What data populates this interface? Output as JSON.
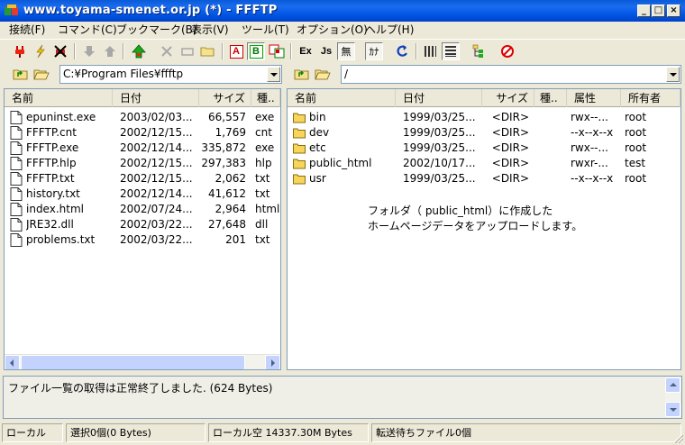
{
  "window": {
    "title": "www.toyama-smenet.or.jp (*) - FFFTP",
    "minimize": "_",
    "maximize": "□",
    "close": "×"
  },
  "menu": [
    {
      "label": "接続(F)"
    },
    {
      "label": "コマンド(C)"
    },
    {
      "label": "ブックマーク(B)"
    },
    {
      "label": "表示(V)"
    },
    {
      "label": "ツール(T)"
    },
    {
      "label": "オプション(O)"
    },
    {
      "label": "ヘルプ(H)"
    }
  ],
  "toolbar": {
    "text_buttons": {
      "ascii": "A",
      "binary": "B",
      "exe_case": "Ex",
      "jis": "Js",
      "no_conv": "無",
      "kana": "ｶﾅ"
    }
  },
  "local": {
    "path": "C:¥Program Files¥ffftp",
    "columns": [
      "名前",
      "日付",
      "サイズ",
      "種.."
    ],
    "files": [
      {
        "name": "epuninst.exe",
        "date": "2003/02/03...",
        "size": "66,557",
        "type": "exe"
      },
      {
        "name": "FFFTP.cnt",
        "date": "2002/12/15...",
        "size": "1,769",
        "type": "cnt"
      },
      {
        "name": "FFFTP.exe",
        "date": "2002/12/14...",
        "size": "335,872",
        "type": "exe"
      },
      {
        "name": "FFFTP.hlp",
        "date": "2002/12/15...",
        "size": "297,383",
        "type": "hlp"
      },
      {
        "name": "FFFTP.txt",
        "date": "2002/12/15...",
        "size": "2,062",
        "type": "txt"
      },
      {
        "name": "history.txt",
        "date": "2002/12/14...",
        "size": "41,612",
        "type": "txt"
      },
      {
        "name": "index.html",
        "date": "2002/07/24...",
        "size": "2,964",
        "type": "html"
      },
      {
        "name": "JRE32.dll",
        "date": "2002/03/22...",
        "size": "27,648",
        "type": "dll"
      },
      {
        "name": "problems.txt",
        "date": "2002/03/22...",
        "size": "201",
        "type": "txt"
      }
    ]
  },
  "remote": {
    "path": "/",
    "columns": [
      "名前",
      "日付",
      "サイズ",
      "種..",
      "属性",
      "所有者"
    ],
    "files": [
      {
        "name": "bin",
        "date": "1999/03/25...",
        "size": "<DIR>",
        "type": "",
        "attr": "rwx--...",
        "owner": "root"
      },
      {
        "name": "dev",
        "date": "1999/03/25...",
        "size": "<DIR>",
        "type": "",
        "attr": "--x--x--x",
        "owner": "root"
      },
      {
        "name": "etc",
        "date": "1999/03/25...",
        "size": "<DIR>",
        "type": "",
        "attr": "rwx--...",
        "owner": "root"
      },
      {
        "name": "public_html",
        "date": "2002/10/17...",
        "size": "<DIR>",
        "type": "",
        "attr": "rwxr-...",
        "owner": "test"
      },
      {
        "name": "usr",
        "date": "1999/03/25...",
        "size": "<DIR>",
        "type": "",
        "attr": "--x--x--x",
        "owner": "root"
      }
    ],
    "note_line1": "フォルダ（ public_html）に作成した",
    "note_line2": "ホームページデータをアップロードします。"
  },
  "log": {
    "message": "ファイル一覧の取得は正常終了しました. (624 Bytes)"
  },
  "status": {
    "location": "ローカル",
    "selection": "選択0個(0 Bytes)",
    "free_space": "ローカル空 14337.30M Bytes",
    "queue": "転送待ちファイル0個"
  }
}
